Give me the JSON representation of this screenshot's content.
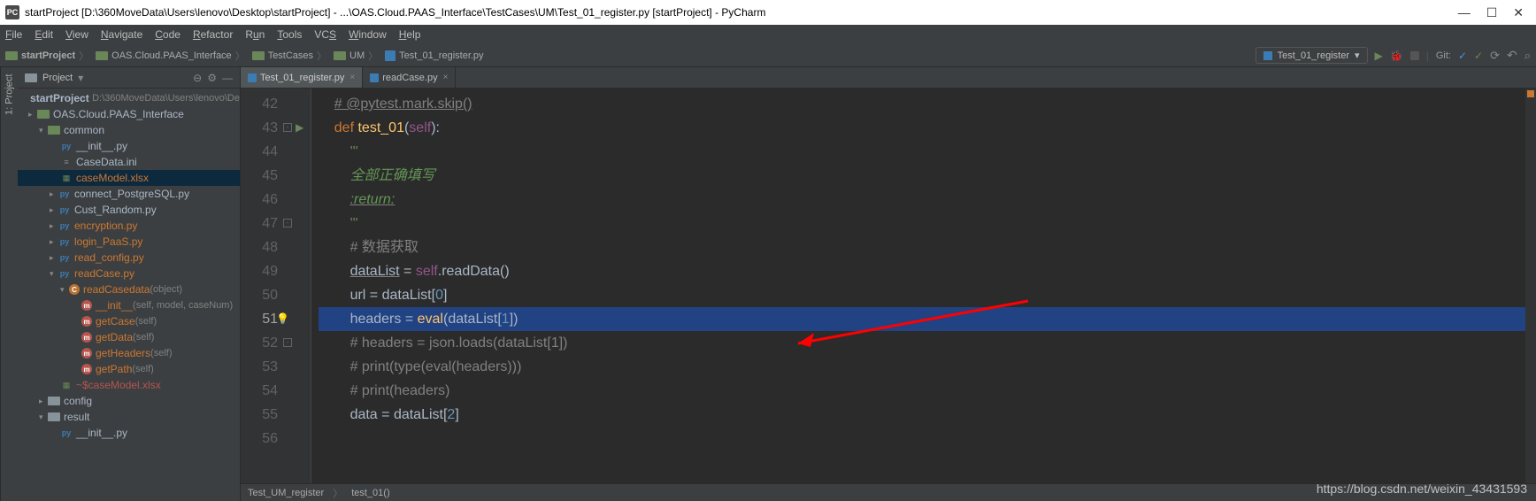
{
  "title": "startProject [D:\\360MoveData\\Users\\lenovo\\Desktop\\startProject] - ...\\OAS.Cloud.PAAS_Interface\\TestCases\\UM\\Test_01_register.py [startProject] - PyCharm",
  "menu": [
    "File",
    "Edit",
    "View",
    "Navigate",
    "Code",
    "Refactor",
    "Run",
    "Tools",
    "VCS",
    "Window",
    "Help"
  ],
  "breadcrumbs": [
    "startProject",
    "OAS.Cloud.PAAS_Interface",
    "TestCases",
    "UM",
    "Test_01_register.py"
  ],
  "run_config": "Test_01_register",
  "git_label": "Git:",
  "project_tool": {
    "title": "Project"
  },
  "root": {
    "name": "startProject",
    "path": "D:\\360MoveData\\Users\\lenovo\\De"
  },
  "tree": {
    "l1": "OAS.Cloud.PAAS_Interface",
    "l2": "common",
    "l3": "__init__.py",
    "l4": "CaseData.ini",
    "l5": "caseModel.xlsx",
    "l6": "connect_PostgreSQL.py",
    "l7": "Cust_Random.py",
    "l8": "encryption.py",
    "l9": "login_PaaS.py",
    "l10": "read_config.py",
    "l11": "readCase.py",
    "l12": "readCasedata",
    "l12p": "(object)",
    "l13": "__init__",
    "l13p": "(self, model, caseNum)",
    "l14": "getCase",
    "l14p": "(self)",
    "l15": "getData",
    "l15p": "(self)",
    "l16": "getHeaders",
    "l16p": "(self)",
    "l17": "getPath",
    "l17p": "(self)",
    "l18": "~$caseModel.xlsx",
    "l19": "config",
    "l20": "result",
    "l21": "__init__.py"
  },
  "tabs": [
    {
      "label": "Test_01_register.py",
      "active": true
    },
    {
      "label": "readCase.py",
      "active": false
    }
  ],
  "lines": {
    "42": "42",
    "43": "43",
    "44": "44",
    "45": "45",
    "46": "46",
    "47": "47",
    "48": "48",
    "49": "49",
    "50": "50",
    "51": "51",
    "52": "52",
    "53": "53",
    "54": "54",
    "55": "55",
    "56": "56"
  },
  "code": {
    "l42": "# @pytest.mark.skip()",
    "l43a": "def",
    "l43b": "test_01",
    "l43c": "self",
    "l44": "'''",
    "l45": "全部正确填写",
    "l46": ":return:",
    "l47": "'''",
    "l48": "# 数据获取",
    "l49a": "dataList",
    "l49b": " = ",
    "l49c": "self",
    "l49d": ".readData()",
    "l50a": "url = dataList[",
    "l50b": "0",
    "l50c": "]",
    "l51a": "headers = ",
    "l51b": "eval",
    "l51c": "(dataList[",
    "l51d": "1",
    "l51e": "])",
    "l52": "# headers = json.loads(dataList[1])",
    "l53": "# print(type(eval(headers)))",
    "l54": "# print(headers)",
    "l55a": "data = dataList[",
    "l55b": "2",
    "l55c": "]"
  },
  "breadcrumb2": {
    "a": "Test_UM_register",
    "b": "test_01()"
  },
  "watermark": "https://blog.csdn.net/weixin_43431593",
  "sidebar_tab": "1: Project"
}
